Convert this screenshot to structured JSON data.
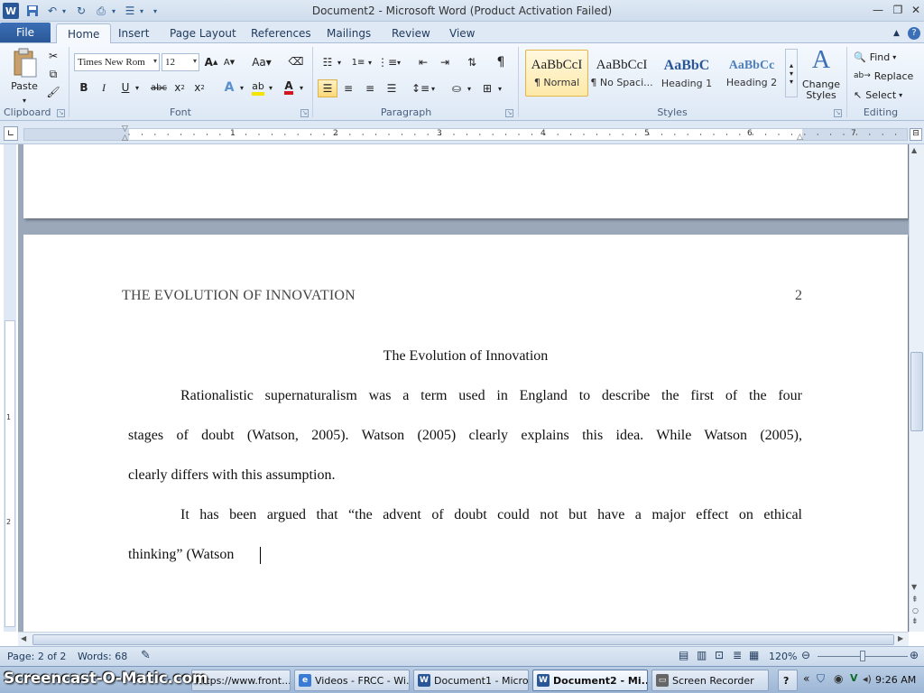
{
  "window": {
    "title": "Document2 - Microsoft Word (Product Activation Failed)",
    "app_icon": "W"
  },
  "tabs": {
    "file": "File",
    "items": [
      {
        "label": "Home",
        "active": true
      },
      {
        "label": "Insert"
      },
      {
        "label": "Page Layout"
      },
      {
        "label": "References"
      },
      {
        "label": "Mailings"
      },
      {
        "label": "Review"
      },
      {
        "label": "View"
      }
    ]
  },
  "ribbon": {
    "clipboard": {
      "label": "Clipboard",
      "paste": "Paste"
    },
    "font": {
      "label": "Font",
      "family": "Times New Rom",
      "size": "12"
    },
    "paragraph": {
      "label": "Paragraph"
    },
    "styles": {
      "label": "Styles",
      "items": [
        {
          "sample": "AaBbCcI",
          "name": "¶ Normal",
          "selected": true
        },
        {
          "sample": "AaBbCcI",
          "name": "¶ No Spaci..."
        },
        {
          "sample": "AaBbC",
          "name": "Heading 1"
        },
        {
          "sample": "AaBbCc",
          "name": "Heading 2"
        }
      ],
      "change_styles": "Change Styles"
    },
    "editing": {
      "label": "Editing",
      "find": "Find",
      "replace": "Replace",
      "select": "Select"
    }
  },
  "ruler": {
    "numbers": [
      "1",
      "2",
      "3",
      "4",
      "5",
      "6",
      "7"
    ],
    "vnumbers": [
      "1",
      "2"
    ]
  },
  "document": {
    "running_head": "THE EVOLUTION OF INNOVATION",
    "page_number": "2",
    "title": "The Evolution of Innovation",
    "lines": [
      "Rationalistic supernaturalism was a term used in England to describe the first of the four",
      "stages of doubt (Watson, 2005).  Watson (2005) clearly explains this idea. While Watson (2005),",
      "clearly differs with this assumption.",
      "It has been argued that “the advent of doubt could not but have a major effect on ethical",
      "thinking” (Watson"
    ]
  },
  "statusbar": {
    "page": "Page: 2 of 2",
    "words": "Words: 68",
    "zoom": "120%"
  },
  "taskbar": {
    "watermark": "Screencast-O-Matic.com",
    "items": [
      {
        "label": "https://www.front..."
      },
      {
        "label": "Videos - FRCC - Wi..."
      },
      {
        "label": "Document1 - Micro..."
      },
      {
        "label": "Document2 - Mi...",
        "active": true
      },
      {
        "label": "Screen Recorder"
      }
    ],
    "time": "9:26 AM"
  },
  "colors": {
    "accent": "#2a5798",
    "ribbon_bg": "#dde8f5",
    "doc_bg": "#9aa8ba"
  }
}
